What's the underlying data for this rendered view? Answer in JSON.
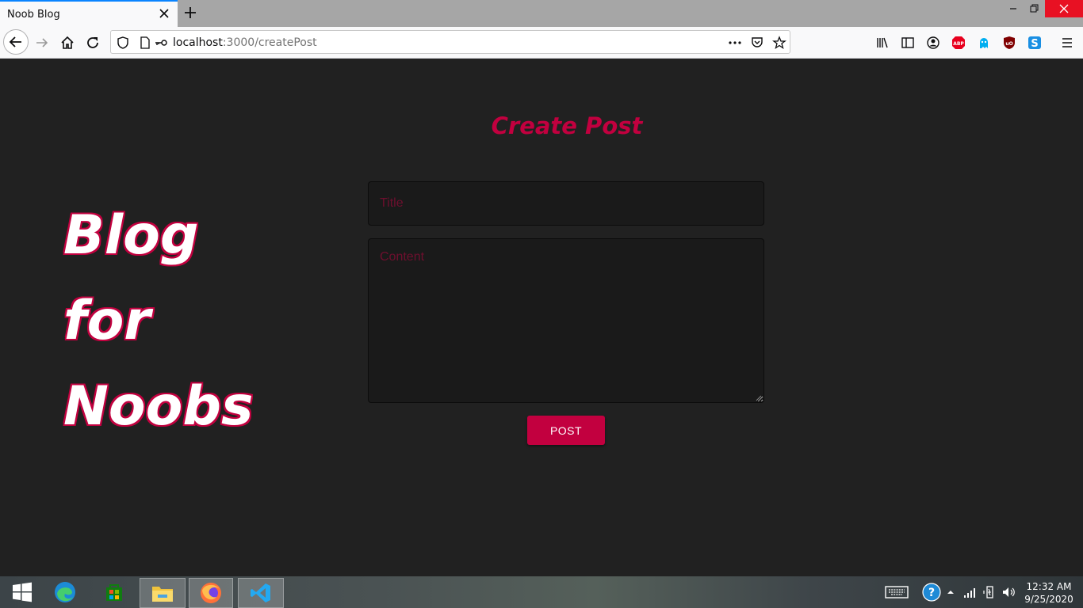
{
  "browser": {
    "tab_title": "Noob Blog",
    "url_host": "localhost",
    "url_rest": ":3000/createPost"
  },
  "page": {
    "heading": "Create Post",
    "hero": [
      "Blog",
      "for",
      "Noobs"
    ],
    "title_placeholder": "Title",
    "content_placeholder": "Content",
    "post_button": "POST",
    "accent_color": "#c2003f",
    "background_color": "#212121"
  },
  "taskbar": {
    "apps": [
      "start-icon",
      "edge-icon",
      "store-icon",
      "file-explorer-icon",
      "firefox-icon",
      "vscode-icon"
    ],
    "time": "12:32 AM",
    "date": "9/25/2020"
  }
}
